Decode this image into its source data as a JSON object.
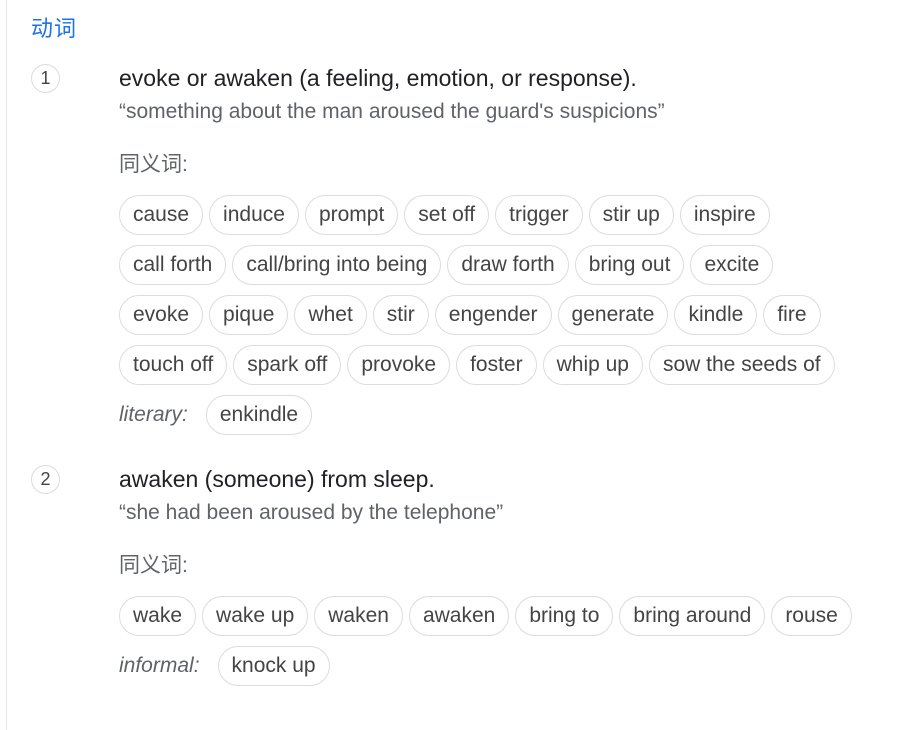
{
  "part_of_speech": "动词",
  "senses": [
    {
      "number": "1",
      "definition": "evoke or awaken (a feeling, emotion, or response).",
      "example": "“something about the man aroused the guard's suspicions”",
      "synonyms_heading": "同义词:",
      "rows": [
        [
          "cause",
          "induce",
          "prompt",
          "set off",
          "trigger",
          "stir up",
          "inspire"
        ],
        [
          "call forth",
          "call/bring into being",
          "draw forth",
          "bring out",
          "excite"
        ],
        [
          "evoke",
          "pique",
          "whet",
          "stir",
          "engender",
          "generate",
          "kindle",
          "fire"
        ],
        [
          "touch off",
          "spark off",
          "provoke",
          "foster",
          "whip up",
          "sow the seeds of"
        ]
      ],
      "register": {
        "label": "literary:",
        "words": [
          "enkindle"
        ]
      }
    },
    {
      "number": "2",
      "definition": "awaken (someone) from sleep.",
      "example": "“she had been aroused by the telephone”",
      "synonyms_heading": "同义词:",
      "rows": [
        [
          "wake",
          "wake up",
          "waken",
          "awaken",
          "bring to",
          "bring around",
          "rouse"
        ]
      ],
      "register": {
        "label": "informal:",
        "words": [
          "knock up"
        ]
      }
    }
  ]
}
